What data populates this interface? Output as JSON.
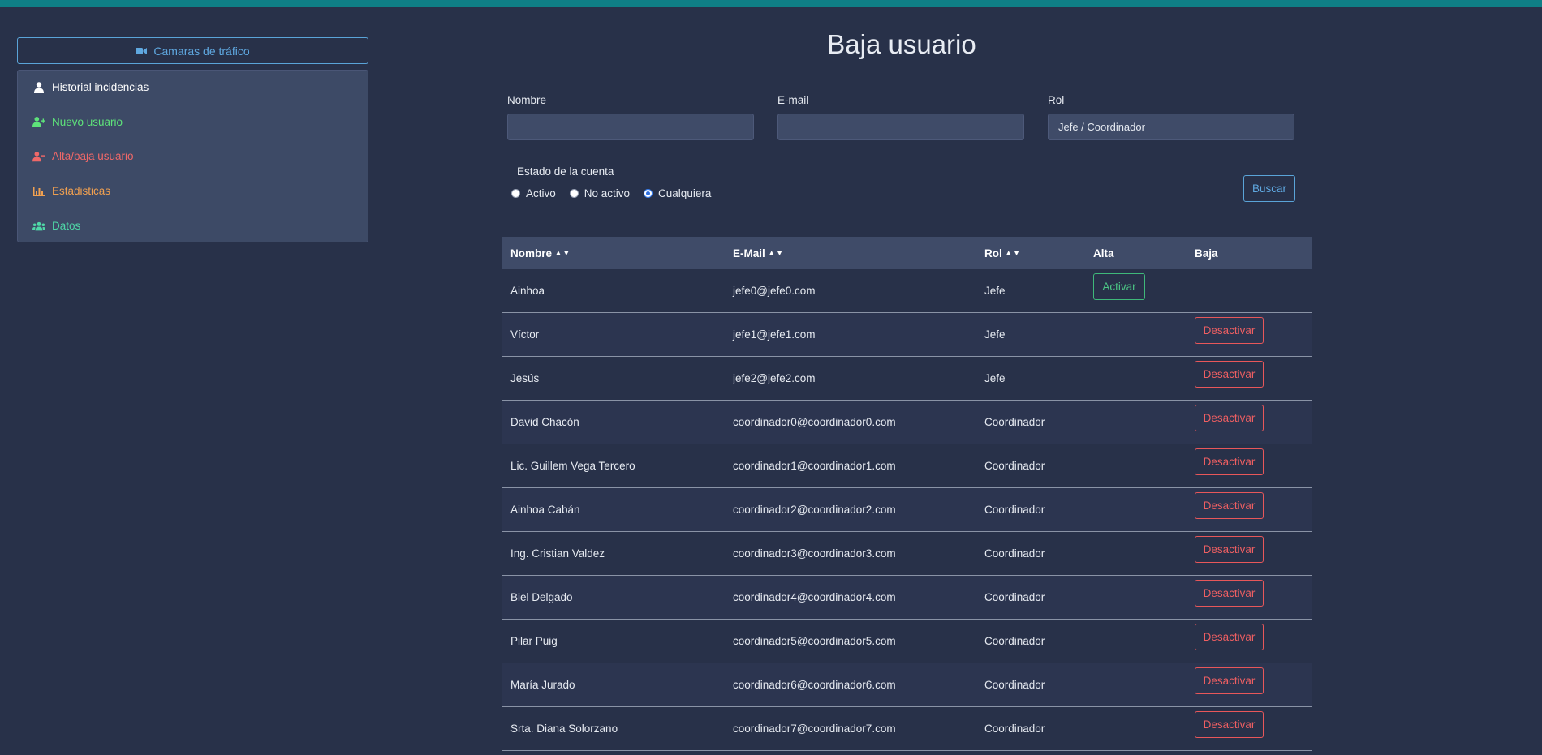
{
  "sidebar": {
    "camera_button": "Camaras de tráfico",
    "items": [
      {
        "label": "Historial incidencias",
        "icon": "user-icon",
        "color": "#ffffff"
      },
      {
        "label": "Nuevo usuario",
        "icon": "user-plus-icon",
        "color": "#5ee37a"
      },
      {
        "label": "Alta/baja usuario",
        "icon": "user-minus-icon",
        "color": "#ef6868"
      },
      {
        "label": "Estadisticas",
        "icon": "chart-bar-icon",
        "color": "#f0a050"
      },
      {
        "label": "Datos",
        "icon": "users-icon",
        "color": "#4fd7a7"
      }
    ]
  },
  "main": {
    "title": "Baja usuario",
    "filters": {
      "nombre_label": "Nombre",
      "nombre_value": "",
      "email_label": "E-mail",
      "email_value": "",
      "rol_label": "Rol",
      "rol_value": "Jefe / Coordinador",
      "estado_label": "Estado de la cuenta",
      "estado_options": [
        "Activo",
        "No activo",
        "Cualquiera"
      ],
      "estado_selected": "Cualquiera",
      "search_button": "Buscar"
    },
    "table": {
      "headers": {
        "nombre": "Nombre",
        "email": "E-Mail",
        "rol": "Rol",
        "alta": "Alta",
        "baja": "Baja"
      },
      "rows": [
        {
          "nombre": "Ainhoa",
          "email": "jefe0@jefe0.com",
          "rol": "Jefe",
          "action": "Activar"
        },
        {
          "nombre": "Víctor",
          "email": "jefe1@jefe1.com",
          "rol": "Jefe",
          "action": "Desactivar"
        },
        {
          "nombre": "Jesús",
          "email": "jefe2@jefe2.com",
          "rol": "Jefe",
          "action": "Desactivar"
        },
        {
          "nombre": "David Chacón",
          "email": "coordinador0@coordinador0.com",
          "rol": "Coordinador",
          "action": "Desactivar"
        },
        {
          "nombre": "Lic. Guillem Vega Tercero",
          "email": "coordinador1@coordinador1.com",
          "rol": "Coordinador",
          "action": "Desactivar"
        },
        {
          "nombre": "Ainhoa Cabán",
          "email": "coordinador2@coordinador2.com",
          "rol": "Coordinador",
          "action": "Desactivar"
        },
        {
          "nombre": "Ing. Cristian Valdez",
          "email": "coordinador3@coordinador3.com",
          "rol": "Coordinador",
          "action": "Desactivar"
        },
        {
          "nombre": "Biel Delgado",
          "email": "coordinador4@coordinador4.com",
          "rol": "Coordinador",
          "action": "Desactivar"
        },
        {
          "nombre": "Pilar Puig",
          "email": "coordinador5@coordinador5.com",
          "rol": "Coordinador",
          "action": "Desactivar"
        },
        {
          "nombre": "María Jurado",
          "email": "coordinador6@coordinador6.com",
          "rol": "Coordinador",
          "action": "Desactivar"
        },
        {
          "nombre": "Srta. Diana Solorzano",
          "email": "coordinador7@coordinador7.com",
          "rol": "Coordinador",
          "action": "Desactivar"
        }
      ]
    }
  }
}
